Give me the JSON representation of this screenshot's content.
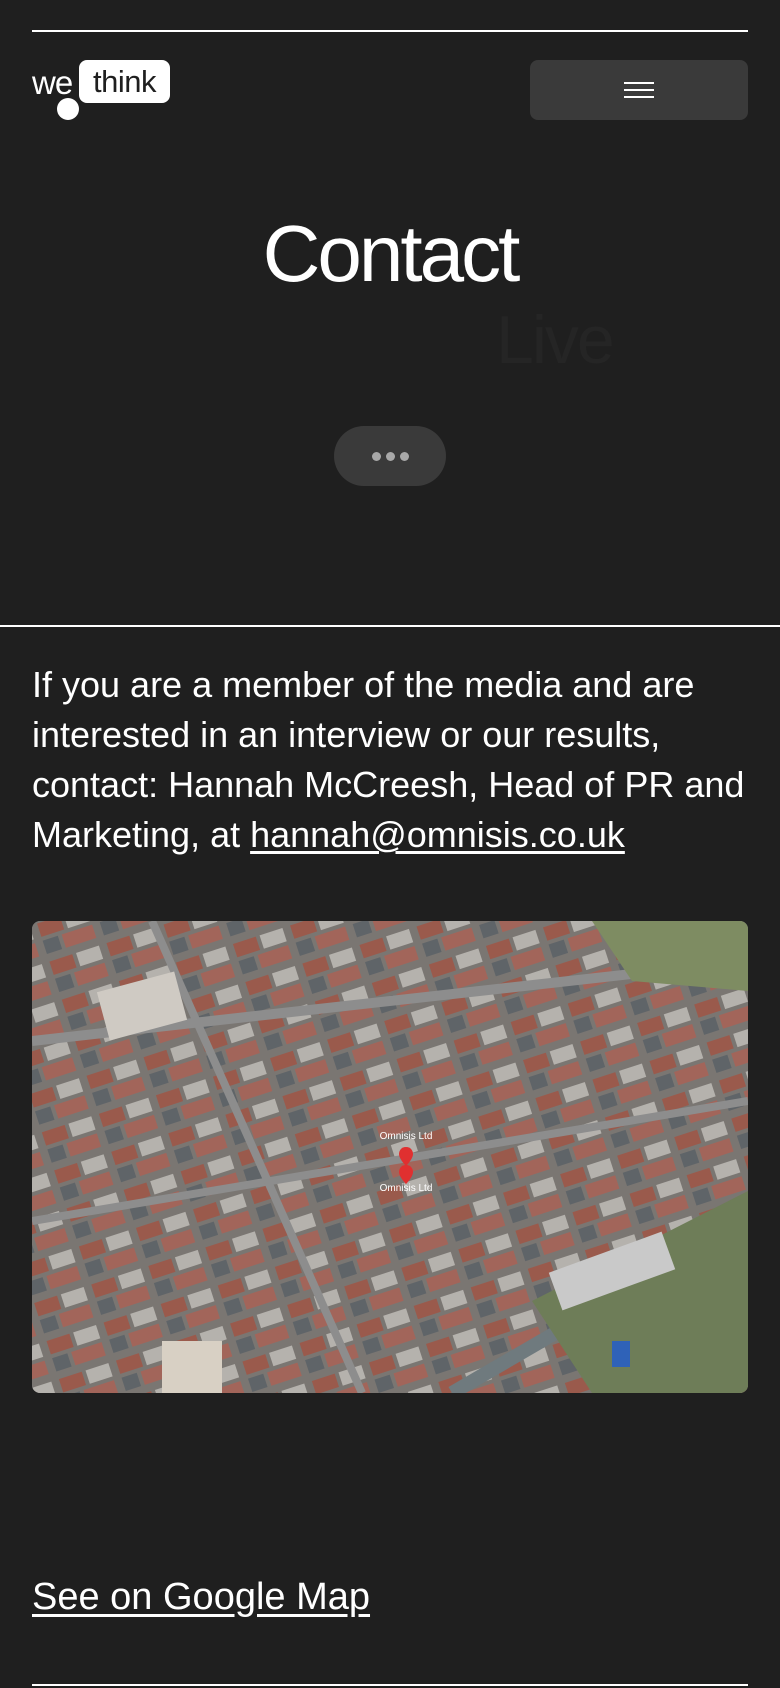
{
  "header": {
    "logo_left": "we",
    "logo_right": "think"
  },
  "hero": {
    "title": "Contact",
    "ghost_word": "Live"
  },
  "intro": {
    "text": "If you are a member of the media and are interested in an interview or our results, contact: Hannah McCreesh, Head of PR and Marketing, at ",
    "email": "hannah@omnisis.co.uk"
  },
  "map": {
    "marker_label_top": "Omnisis Ltd",
    "marker_label_bottom": "Omnisis Ltd",
    "marker_color": "#e03030"
  },
  "footer": {
    "map_link": "See on Google Map"
  },
  "colors": {
    "background": "#1f1f1f",
    "button": "#3a3a3a",
    "text": "#ffffff"
  }
}
